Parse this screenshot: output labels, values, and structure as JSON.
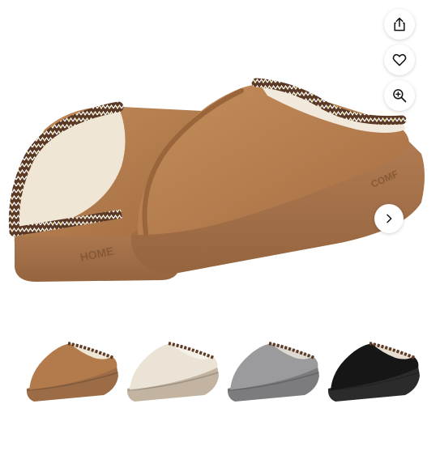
{
  "gallery": {
    "actions": [
      {
        "icon": "share-icon"
      },
      {
        "icon": "heart-icon"
      },
      {
        "icon": "zoom-in-icon"
      }
    ],
    "next_icon": "chevron-right-icon",
    "main_image": {
      "brand_text_left": "HOME",
      "brand_text_right": "COMF"
    },
    "thumbnails": [
      {
        "color_name": "chestnut",
        "upper": "#b37a4c",
        "sole": "#9c6c47",
        "lining": "#efe6d6"
      },
      {
        "color_name": "beige",
        "upper": "#ebe3d5",
        "sole": "#c2b4a1",
        "lining": "#f5f0e8"
      },
      {
        "color_name": "grey",
        "upper": "#9b9b9d",
        "sole": "#7c7c7e",
        "lining": "#dedad3"
      },
      {
        "color_name": "black",
        "upper": "#161616",
        "sole": "#2b2b2b",
        "lining": "#e7ddd0"
      }
    ],
    "colors": {
      "chestnut": "#b27a4b",
      "sole": "#a06f46",
      "lining": "#f1e9dc",
      "trim_brown": "#5b3a25",
      "trim_gold": "#c99a2e"
    }
  }
}
